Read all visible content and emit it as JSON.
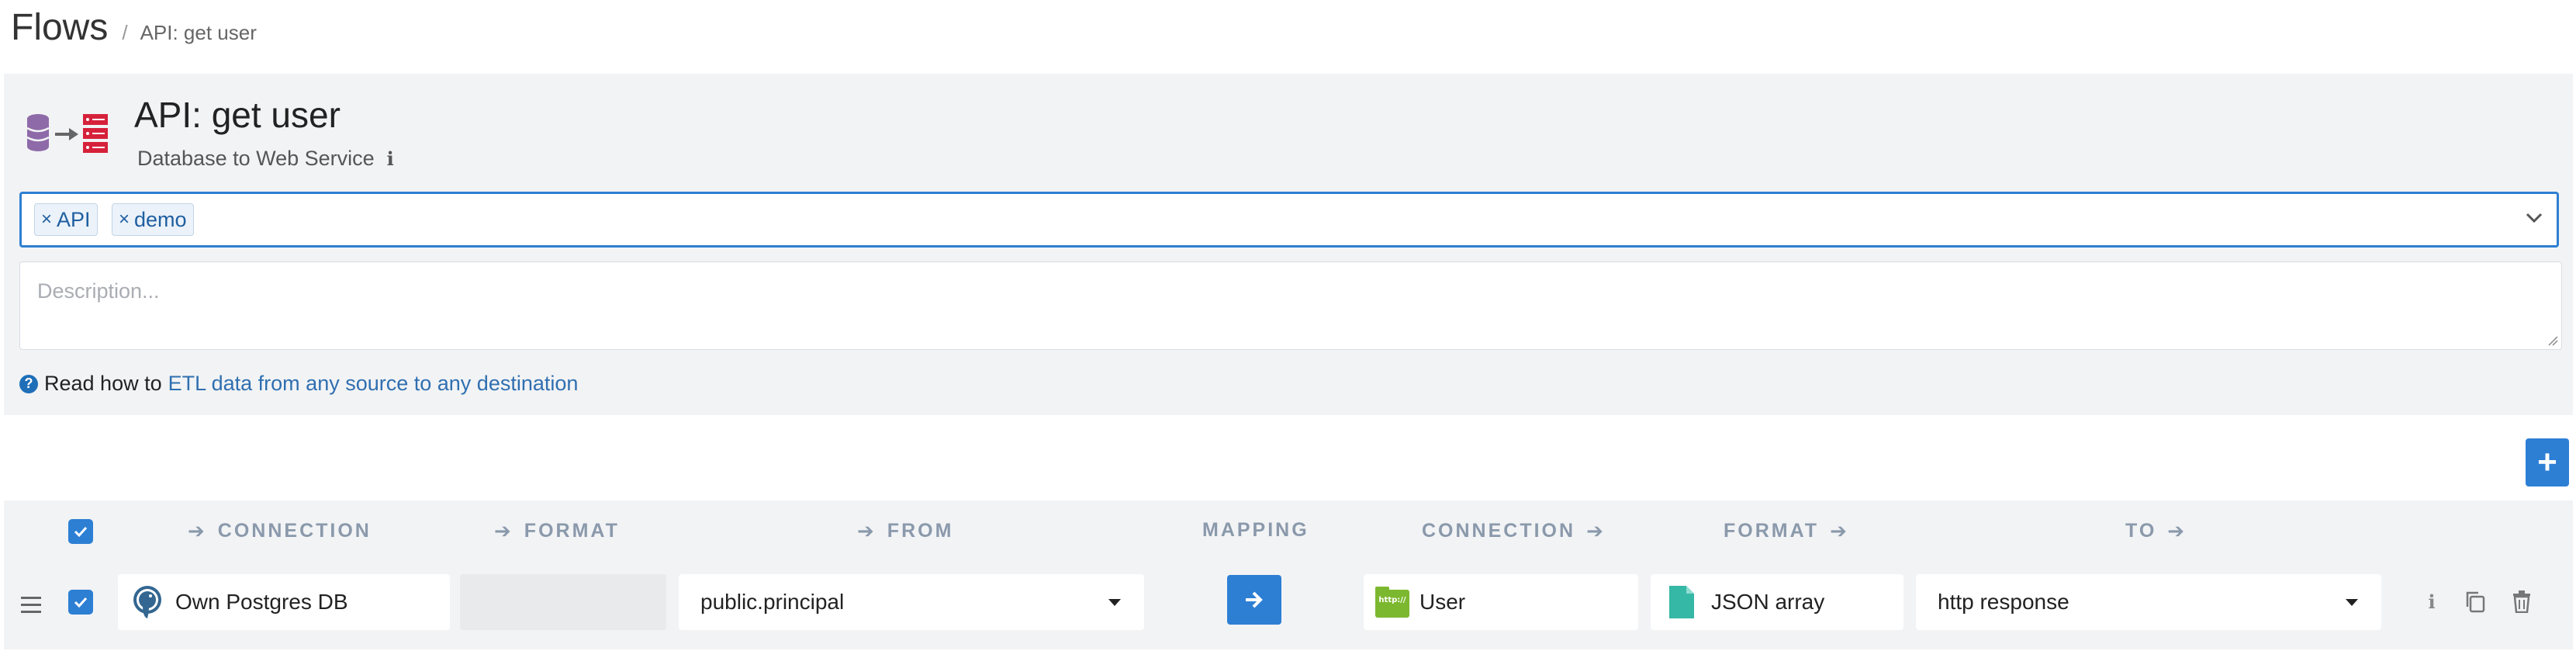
{
  "header": {
    "title": "Flows",
    "breadcrumb_sep": "/",
    "breadcrumb_current": "API: get user"
  },
  "flow": {
    "name": "API: get user",
    "type": "Database to Web Service",
    "tags": [
      "API",
      "demo"
    ],
    "description_placeholder": "Description...",
    "help_lead": "Read how to",
    "help_link": "ETL data from any source to any destination"
  },
  "table": {
    "headers": {
      "src_connection": "CONNECTION",
      "src_format": "FORMAT",
      "from": "FROM",
      "mapping": "MAPPING",
      "dst_connection": "CONNECTION",
      "dst_format": "FORMAT",
      "to": "TO"
    },
    "select_all_checked": true,
    "rows": [
      {
        "checked": true,
        "src_connection": "Own Postgres DB",
        "src_format": "",
        "from": "public.principal",
        "dst_connection": "User",
        "dst_format": "JSON array",
        "to": "http response"
      }
    ]
  },
  "icons": {
    "flow": "database-to-web-service-icon",
    "src_connection": "postgres-elephant-icon",
    "dst_connection": "http-web-icon",
    "dst_format": "json-file-icon",
    "mapping": "arrow-right-icon",
    "add": "plus-icon",
    "row_info": "info-icon",
    "row_copy": "copy-icon",
    "row_delete": "trash-icon",
    "drag": "drag-handle-icon"
  },
  "colors": {
    "accent": "#2d7fd4",
    "panel_bg": "#f2f3f5",
    "header_text": "#8a99ab",
    "link": "#2f6fb0"
  }
}
